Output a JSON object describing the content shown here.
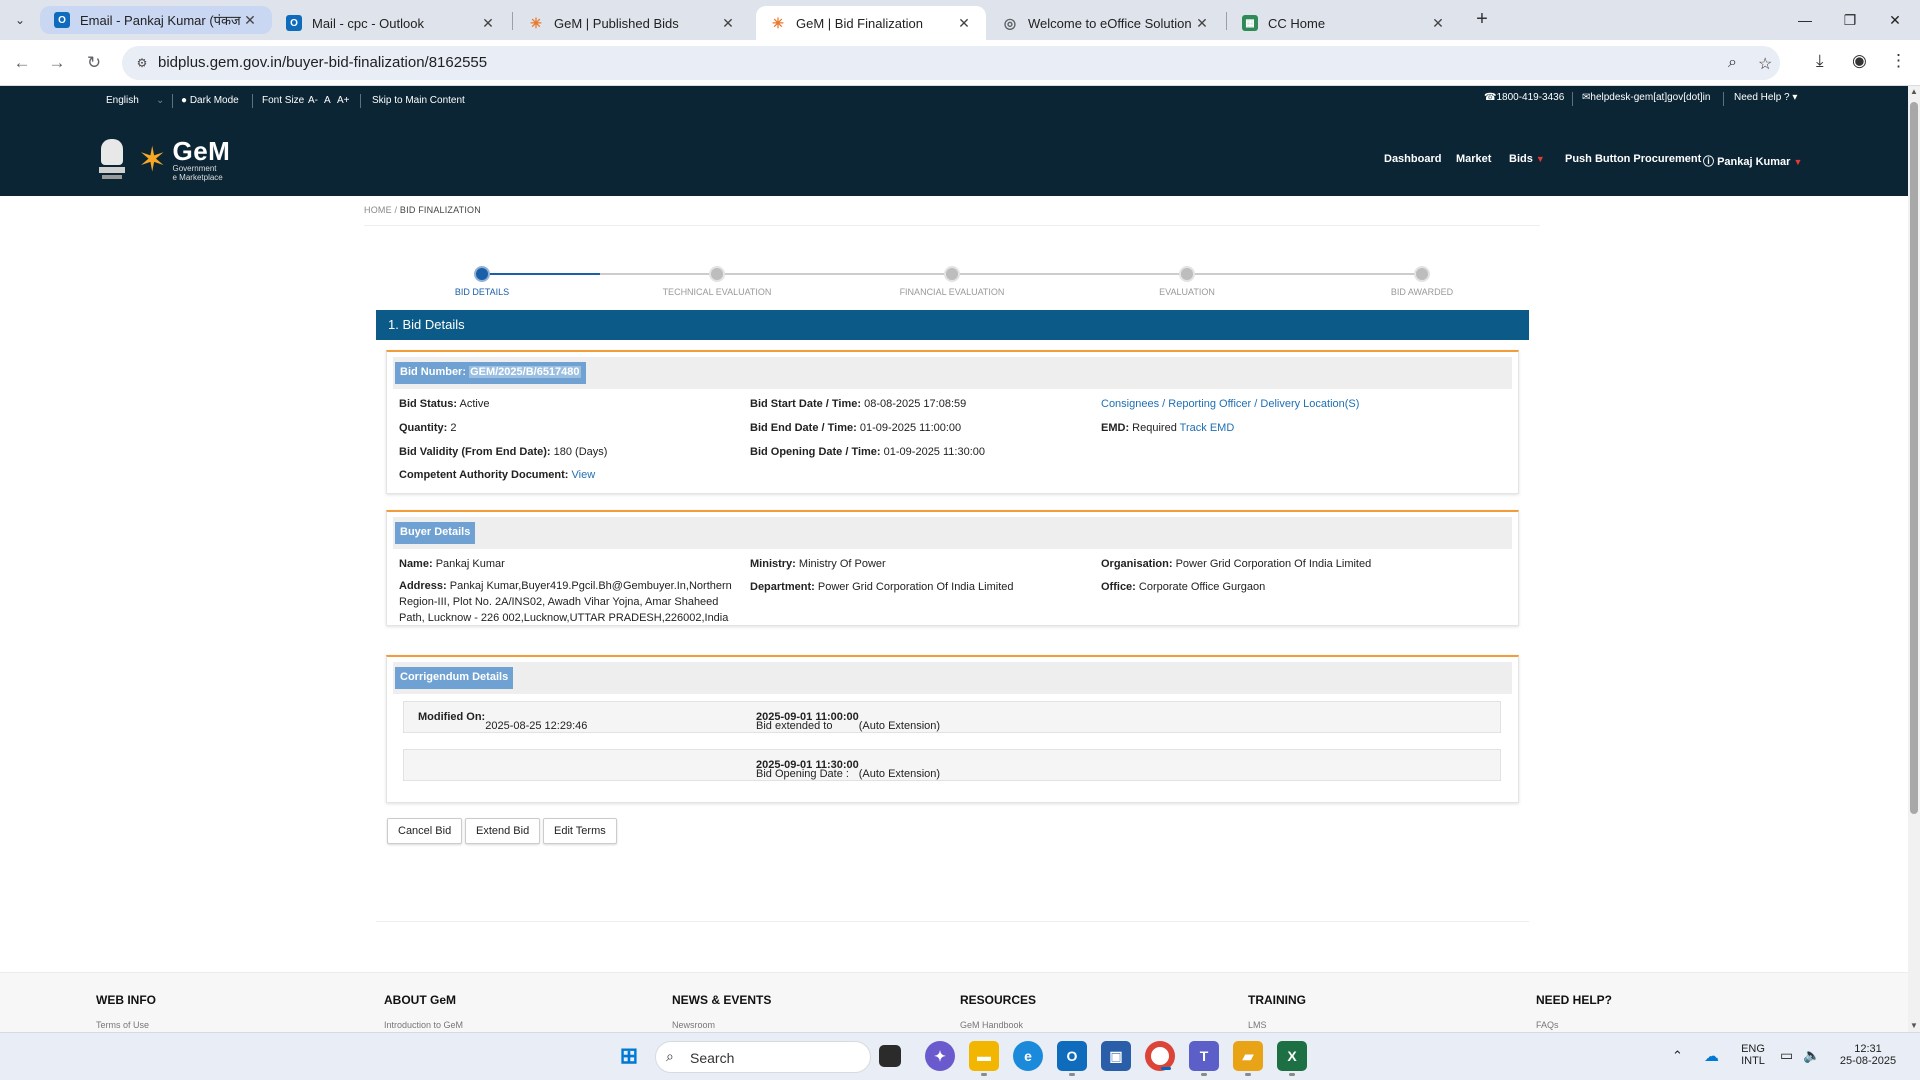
{
  "browser": {
    "tabs": [
      {
        "title": "Email - Pankaj Kumar (पंकज कु",
        "icon": "outlook-icon"
      },
      {
        "title": "Mail - cpc - Outlook",
        "icon": "outlook-icon"
      },
      {
        "title": "GeM | Published Bids",
        "icon": "gem-icon"
      },
      {
        "title": "GeM | Bid Finalization",
        "icon": "gem-icon"
      },
      {
        "title": "Welcome to eOffice Solution",
        "icon": "globe-icon"
      },
      {
        "title": "CC Home",
        "icon": "cc-icon"
      }
    ],
    "url": "bidplus.gem.gov.in/buyer-bid-finalization/8162555"
  },
  "site": {
    "topbar": {
      "language": "English",
      "dark_mode": "Dark Mode",
      "font_size": "Font Size",
      "font_small": "A-",
      "font_normal": "A",
      "font_large": "A+",
      "skip": "Skip to Main Content",
      "phone": "1800-419-3436",
      "email": "helpdesk-gem[at]gov[dot]in",
      "help": "Need Help ?"
    },
    "logo": {
      "name": "GeM",
      "sub1": "Government",
      "sub2": "e Marketplace"
    },
    "nav": {
      "dashboard": "Dashboard",
      "market": "Market",
      "bids": "Bids",
      "push_button": "Push Button Procurement",
      "user": "Pankaj Kumar"
    }
  },
  "breadcrumb": {
    "home": "HOME",
    "sep": "/",
    "current": "BID FINALIZATION"
  },
  "stepper": {
    "steps": [
      "BID DETAILS",
      "TECHNICAL EVALUATION",
      "FINANCIAL EVALUATION",
      "EVALUATION",
      "BID AWARDED"
    ],
    "active_index": 0
  },
  "section_title": "1. Bid Details",
  "bid_details": {
    "bid_number_label": "Bid Number:",
    "bid_number": "GEM/2025/B/6517480",
    "status_label": "Bid Status:",
    "status": "Active",
    "quantity_label": "Quantity:",
    "quantity": "2",
    "validity_label": "Bid Validity (From End Date):",
    "validity": "180 (Days)",
    "competent_label": "Competent Authority Document:",
    "competent_link": "View",
    "start_label": "Bid Start Date / Time:",
    "start": "08-08-2025 17:08:59",
    "end_label": "Bid End Date / Time:",
    "end": "01-09-2025 11:00:00",
    "opening_label": "Bid Opening Date / Time:",
    "opening": "01-09-2025 11:30:00",
    "consignees_link": "Consignees / Reporting Officer / Delivery Location(S)",
    "emd_label": "EMD:",
    "emd": "Required",
    "emd_link": "Track EMD"
  },
  "buyer_details": {
    "title": "Buyer Details",
    "name_label": "Name:",
    "name": "Pankaj Kumar",
    "address_label": "Address:",
    "address": "Pankaj Kumar,Buyer419.Pgcil.Bh@Gembuyer.In,Northern Region-III, Plot No. 2A/INS02, Awadh Vihar Yojna, Amar Shaheed Path, Lucknow - 226 002,Lucknow,UTTAR PRADESH,226002,India",
    "ministry_label": "Ministry:",
    "ministry": "Ministry Of Power",
    "department_label": "Department:",
    "department": "Power Grid Corporation Of India Limited",
    "organisation_label": "Organisation:",
    "organisation": "Power Grid Corporation Of India Limited",
    "office_label": "Office:",
    "office": "Corporate Office Gurgaon"
  },
  "corrigendum": {
    "title": "Corrigendum Details",
    "modified_label": "Modified On:",
    "modified": "2025-08-25 12:29:46",
    "extended_prefix": "Bid extended to",
    "extended_value": "2025-09-01 11:00:00",
    "extended_suffix": "(Auto Extension)",
    "opening_prefix": "Bid Opening Date :",
    "opening_value": "2025-09-01 11:30:00",
    "opening_suffix": "(Auto Extension)"
  },
  "actions": {
    "cancel": "Cancel Bid",
    "extend": "Extend Bid",
    "edit": "Edit Terms"
  },
  "footer": [
    {
      "heading": "WEB INFO",
      "link": "Terms of Use"
    },
    {
      "heading": "ABOUT GeM",
      "link": "Introduction to GeM"
    },
    {
      "heading": "NEWS & EVENTS",
      "link": "Newsroom"
    },
    {
      "heading": "RESOURCES",
      "link": "GeM Handbook"
    },
    {
      "heading": "TRAINING",
      "link": "LMS"
    },
    {
      "heading": "NEED HELP?",
      "link": "FAQs"
    }
  ],
  "taskbar": {
    "search_placeholder": "Search",
    "lang1": "ENG",
    "lang2": "INTL",
    "time": "12:31",
    "date": "25-08-2025"
  },
  "colors": {
    "header_bg": "#0b2535",
    "section_bar": "#0c5a87",
    "card_accent": "#f29d38",
    "link": "#1f6fb5",
    "pill": "#6fa2d2"
  }
}
